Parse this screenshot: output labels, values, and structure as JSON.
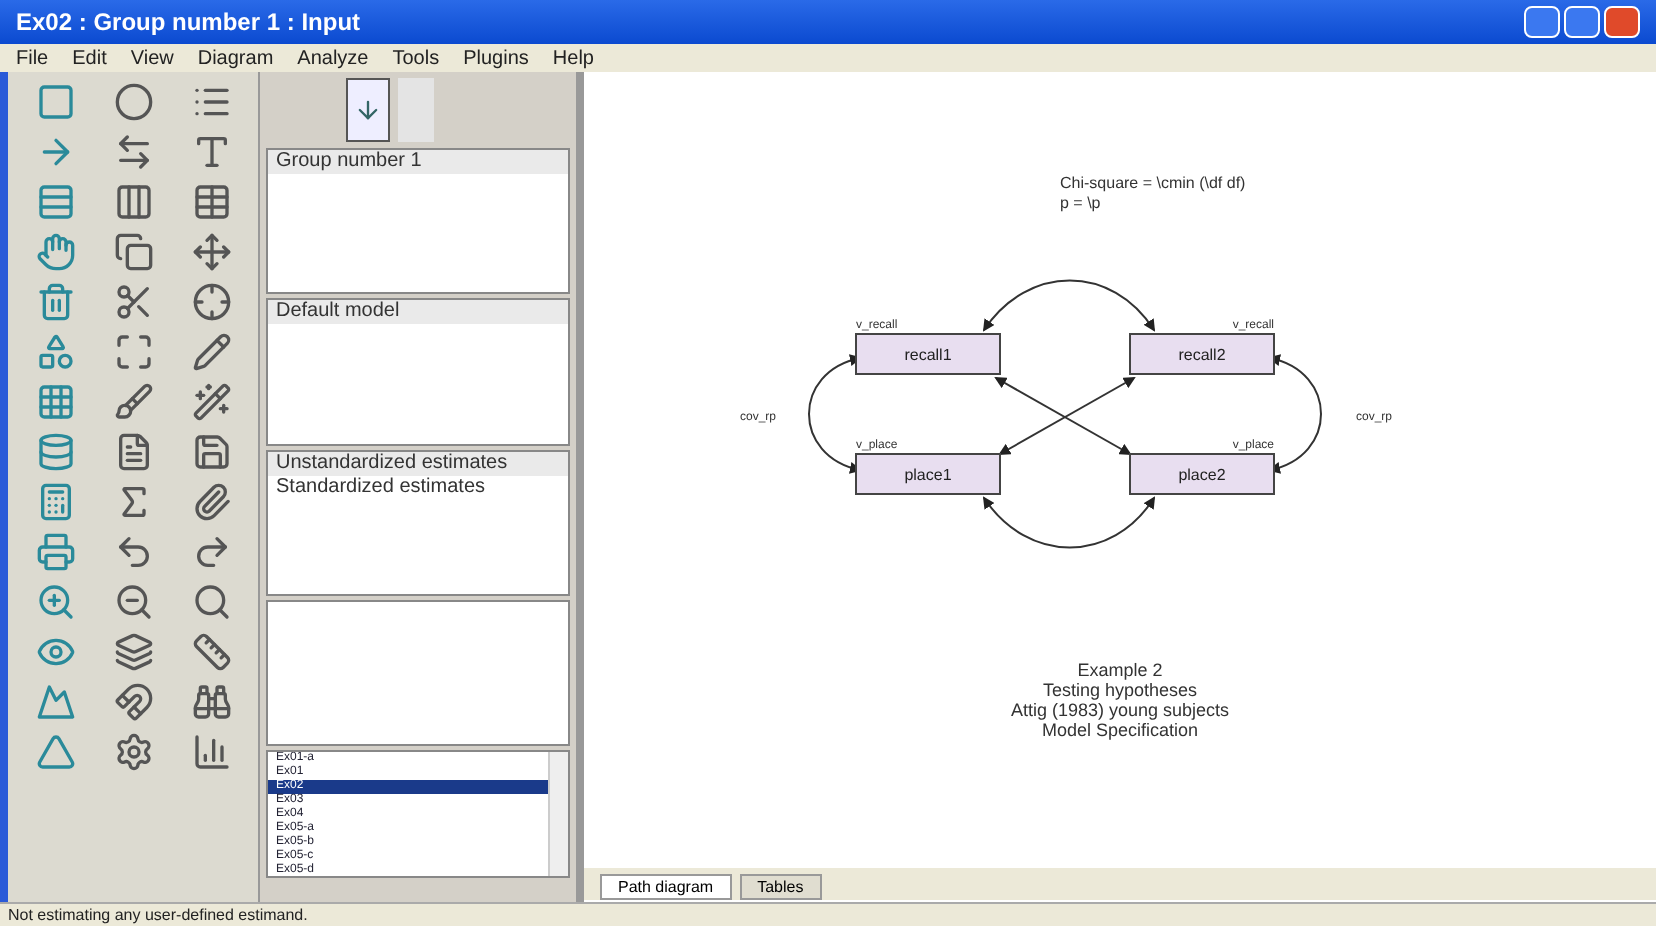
{
  "window": {
    "title": "Ex02 : Group number 1 : Input"
  },
  "menu": [
    "File",
    "Edit",
    "View",
    "Diagram",
    "Analyze",
    "Tools",
    "Plugins",
    "Help"
  ],
  "panel": {
    "groups": [
      "Group number 1"
    ],
    "models": [
      "Default model"
    ],
    "estimates": [
      "Unstandardized estimates",
      "Standardized estimates"
    ]
  },
  "files": [
    {
      "name": "Ex01-a",
      "selected": false
    },
    {
      "name": "Ex01",
      "selected": false
    },
    {
      "name": "Ex02",
      "selected": true
    },
    {
      "name": "Ex03",
      "selected": false
    },
    {
      "name": "Ex04",
      "selected": false
    },
    {
      "name": "Ex05-a",
      "selected": false
    },
    {
      "name": "Ex05-b",
      "selected": false
    },
    {
      "name": "Ex05-c",
      "selected": false
    },
    {
      "name": "Ex05-d",
      "selected": false
    }
  ],
  "diagram": {
    "fit_text": [
      "Chi-square = \\cmin (\\df df)",
      "p = \\p"
    ],
    "variables": [
      {
        "name": "recall1",
        "variance": "v_recall"
      },
      {
        "name": "recall2",
        "variance": "v_recall"
      },
      {
        "name": "place1",
        "variance": "v_place"
      },
      {
        "name": "place2",
        "variance": "v_place"
      }
    ],
    "covariance_labels": [
      "cov_rp",
      "cov_rp"
    ],
    "caption": [
      "Example 2",
      "Testing hypotheses",
      "Attig (1983) young subjects",
      "Model Specification"
    ]
  },
  "tabs": [
    {
      "label": "Path diagram",
      "selected": true
    },
    {
      "label": "Tables",
      "selected": false
    }
  ],
  "status_bar": "Not estimating any user-defined estimand."
}
